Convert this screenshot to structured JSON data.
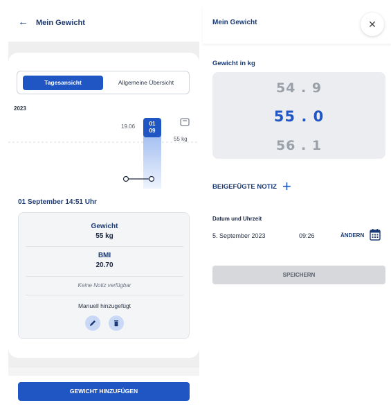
{
  "left": {
    "header": {
      "back_icon": "arrow-left-icon",
      "title": "Mein Gewicht"
    },
    "tabs": [
      {
        "label": "Tagesansicht",
        "active": true
      },
      {
        "label": "Allgemeine Übersicht",
        "active": false
      }
    ],
    "year": "2023",
    "chart": {
      "prev_date": "19.06",
      "selected_date_line1": "01",
      "selected_date_line2": "09",
      "weight_label": "55 kg",
      "icon": "scale-icon"
    },
    "detail_title": "01 September 14:51 Uhr",
    "detail": {
      "weight_label": "Gewicht",
      "weight_value": "55 kg",
      "bmi_label": "BMI",
      "bmi_value": "20.70",
      "note": "Keine Notiz verfügbar",
      "source": "Manuell hinzugefügt",
      "edit_icon": "pencil-icon",
      "delete_icon": "trash-icon"
    },
    "add_button": "GEWICHT HINZUFÜGEN"
  },
  "right": {
    "title": "Mein Gewicht",
    "close_icon": "close-icon",
    "weight_label": "Gewicht in kg",
    "picker": {
      "above": "54 . 9",
      "selected": "55 . 0",
      "below": "56 . 1"
    },
    "note_label": "BEIGEFÜGTE NOTIZ",
    "plus_icon": "plus-icon",
    "datetime_label": "Datum und Uhrzeit",
    "date_value": "5. September 2023",
    "time_value": "09:26",
    "change_label": "ÄNDERN",
    "calendar_icon": "calendar-icon",
    "save_button": "SPEICHERN"
  },
  "colors": {
    "primary": "#1f56c4",
    "title": "#1b3a73",
    "background_gray": "#efefef",
    "disabled": "#d6d8dc"
  }
}
